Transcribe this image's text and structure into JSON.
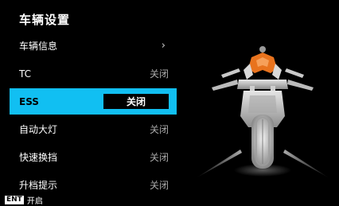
{
  "header": {
    "title": "车辆设置"
  },
  "menu": [
    {
      "label": "车辆信息",
      "value": "",
      "chevron": "›"
    },
    {
      "label": "TC",
      "value": "关闭"
    },
    {
      "label": "ESS",
      "value": "关闭",
      "active": true
    },
    {
      "label": "自动大灯",
      "value": "关闭"
    },
    {
      "label": "快速换挡",
      "value": "关闭"
    },
    {
      "label": "升档提示",
      "value": "关闭"
    }
  ],
  "footer": {
    "key": "ENT",
    "action": "开启"
  },
  "colors": {
    "accent": "#11bff2",
    "background": "#000000",
    "bike_orange": "#e8731e"
  },
  "image": {
    "icon": "motorcycle-front-view"
  }
}
